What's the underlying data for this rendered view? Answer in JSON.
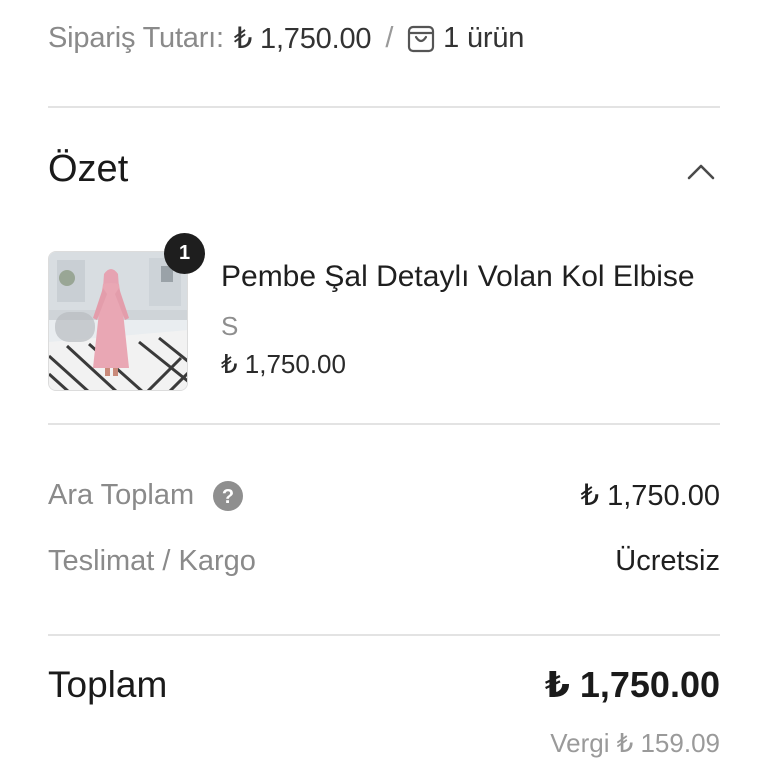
{
  "order": {
    "label": "Sipariş Tutarı:",
    "amount": "₺ 1,750.00",
    "separator": "/",
    "item_count": "1 ürün",
    "bag_icon": "shopping-bag-icon"
  },
  "summary": {
    "title": "Özet",
    "toggle_icon": "chevron-up-icon"
  },
  "product": {
    "quantity_badge": "1",
    "name": "Pembe Şal Detaylı Volan Kol Elbise",
    "variant": "S",
    "price": "₺ 1,750.00",
    "image_alt": "pink dress product photo"
  },
  "totals": {
    "subtotal_label": "Ara Toplam",
    "subtotal_value": "₺ 1,750.00",
    "help_icon": "question-mark-icon",
    "shipping_label": "Teslimat / Kargo",
    "shipping_value": "Ücretsiz",
    "total_label": "Toplam",
    "total_value": "₺ 1,750.00",
    "tax_text": "Vergi ₺ 159.09"
  },
  "colors": {
    "text_primary": "#1f1f1f",
    "text_muted": "#8a8a8a",
    "badge_bg": "#1e1e1e",
    "divider": "#e3e3e3",
    "dress_pink": "#e9a7b4"
  }
}
